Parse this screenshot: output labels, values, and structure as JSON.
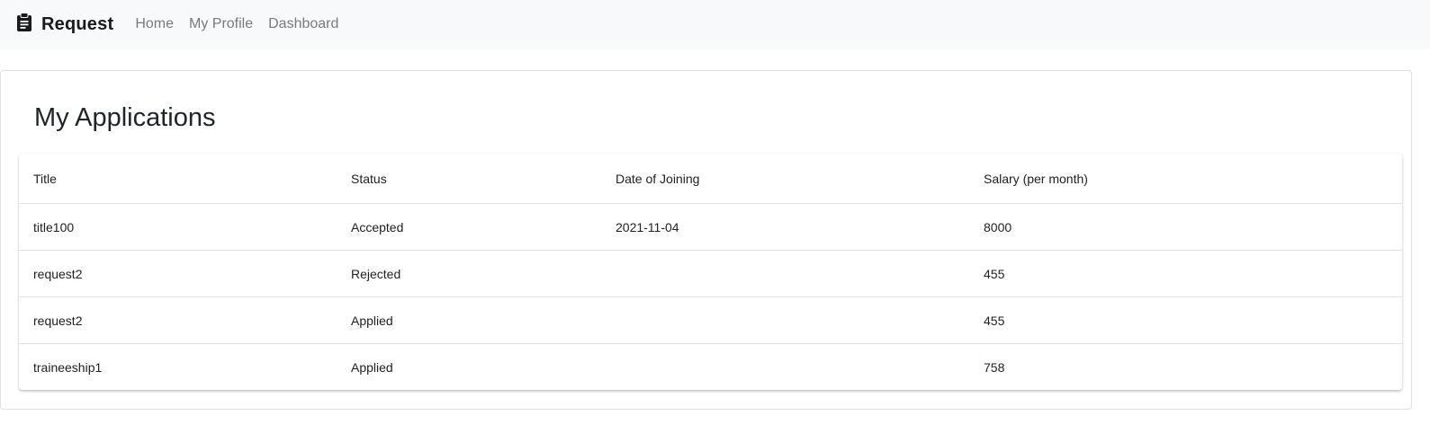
{
  "navbar": {
    "brand": "Request",
    "brand_icon": "clipboard-icon",
    "links": [
      {
        "label": "Home"
      },
      {
        "label": "My Profile"
      },
      {
        "label": "Dashboard"
      }
    ]
  },
  "main": {
    "title": "My Applications",
    "table": {
      "headers": [
        "Title",
        "Status",
        "Date of Joining",
        "Salary (per month)"
      ],
      "rows": [
        [
          "title100",
          "Accepted",
          "2021-11-04",
          "8000"
        ],
        [
          "request2",
          "Rejected",
          "",
          "455"
        ],
        [
          "request2",
          "Applied",
          "",
          "455"
        ],
        [
          "traineeship1",
          "Applied",
          "",
          "758"
        ]
      ]
    }
  },
  "colors": {
    "navbar_bg": "#f8f9fa",
    "nav_link": "#7a7a7a",
    "border": "#e0e0e0"
  }
}
